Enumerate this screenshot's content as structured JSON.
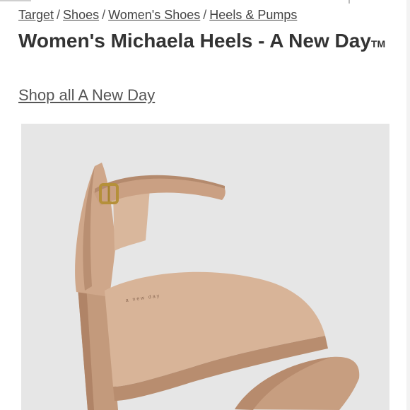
{
  "breadcrumb": {
    "items": [
      {
        "label": "Target"
      },
      {
        "label": "Shoes"
      },
      {
        "label": "Women's Shoes"
      },
      {
        "label": "Heels & Pumps"
      }
    ],
    "separator": "/"
  },
  "product": {
    "title": "Women's Michaela Heels - A New Day",
    "trademark": "TM",
    "shop_link": "Shop all A New Day",
    "image": {
      "alt": "Tan ankle-strap block heel sandal",
      "insole_brand_text": "a new day"
    }
  },
  "colors": {
    "text": "#333333",
    "link": "#444444",
    "image_background": "#e4e4e4",
    "shoe_tan": "#c9a183"
  }
}
